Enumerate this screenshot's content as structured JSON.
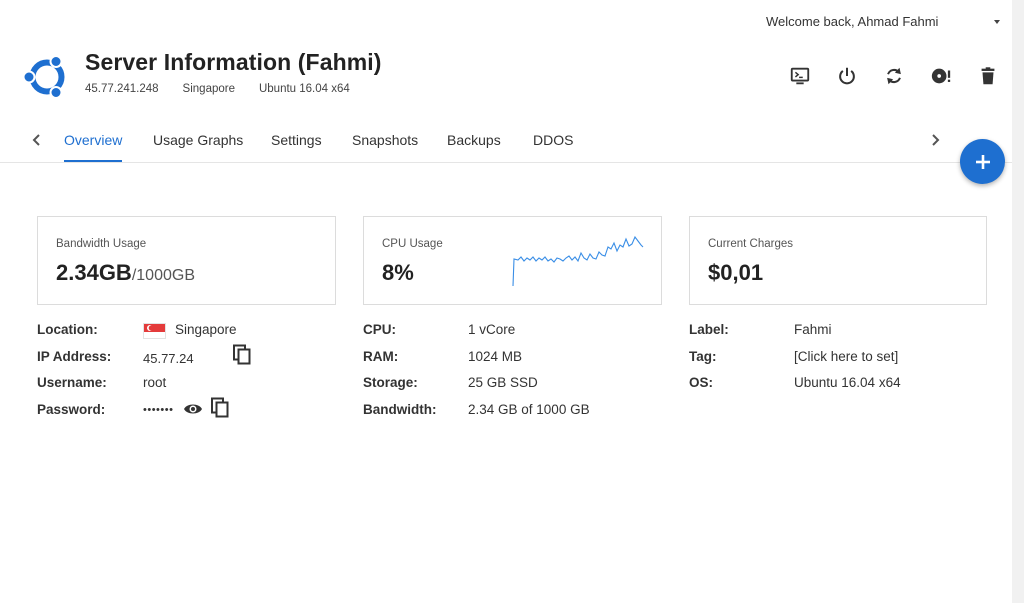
{
  "user": {
    "welcome": "Welcome back, Ahmad Fahmi"
  },
  "server": {
    "title": "Server Information (Fahmi)",
    "ip": "45.77.241.248",
    "location": "Singapore",
    "os": "Ubuntu 16.04 x64"
  },
  "actions": [
    "console-icon",
    "power-icon",
    "restart-icon",
    "reinstall-icon",
    "delete-icon"
  ],
  "tabs": [
    {
      "label": "Overview",
      "active": true
    },
    {
      "label": "Usage Graphs"
    },
    {
      "label": "Settings"
    },
    {
      "label": "Snapshots"
    },
    {
      "label": "Backups"
    },
    {
      "label": "DDOS"
    }
  ],
  "cards": {
    "bandwidth": {
      "label": "Bandwidth Usage",
      "value": "2.34GB",
      "sub": "/1000GB"
    },
    "cpu": {
      "label": "CPU Usage",
      "value": "8%"
    },
    "charges": {
      "label": "Current Charges",
      "value": "$0,01"
    }
  },
  "left_info": {
    "location_label": "Location:",
    "location_value": "Singapore",
    "ip_label": "IP Address:",
    "ip_value": "45.77.24",
    "username_label": "Username:",
    "username_value": "root",
    "password_label": "Password:",
    "password_value": "•••••••"
  },
  "mid_info": {
    "cpu_label": "CPU:",
    "cpu_value": "1 vCore",
    "ram_label": "RAM:",
    "ram_value": "1024 MB",
    "storage_label": "Storage:",
    "storage_value": "25 GB SSD",
    "bandwidth_label": "Bandwidth:",
    "bandwidth_value": "2.34 GB of 1000 GB"
  },
  "right_info": {
    "label_label": "Label:",
    "label_value": "Fahmi",
    "tag_label": "Tag:",
    "tag_value": "[Click here to set]",
    "os_label": "OS:",
    "os_value": "Ubuntu 16.04 x64"
  },
  "colors": {
    "accent": "#1e6fd0",
    "flag_red": "#e43b3b"
  }
}
